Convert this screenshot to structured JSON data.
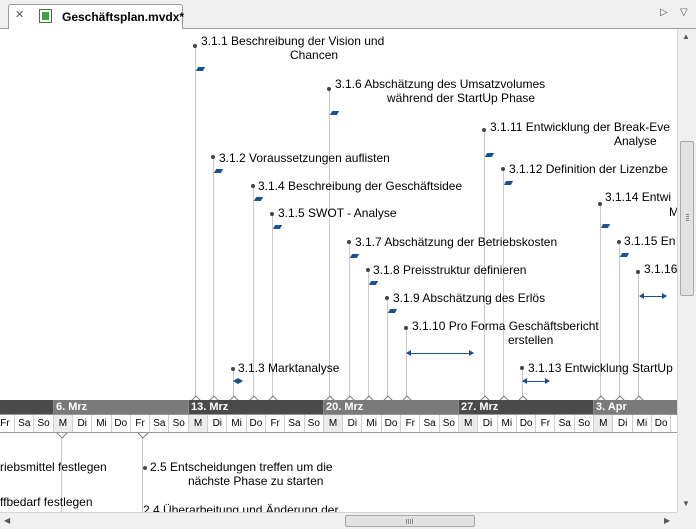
{
  "tab": {
    "title": "Geschäftsplan.mvdx*",
    "close_icon": "close-icon",
    "file_icon": "visio-file-icon"
  },
  "tasks": {
    "t311": "3.1.1  Beschreibung der Vision und",
    "t311b": "Chancen",
    "t316": "3.1.6  Abschätzung des Umsatzvolumes",
    "t316b": "während der StartUp Phase",
    "t3111": "3.1.11  Entwicklung der Break-Eve",
    "t3111b": "Analyse",
    "t312": "3.1.2  Voraussetzungen auflisten",
    "t3112": "3.1.12  Definition der Lizenzbe",
    "t314": "3.1.4  Beschreibung der Geschäftsidee",
    "t3114": "3.1.14  Entwi",
    "t3114b": "M",
    "t315": "3.1.5  SWOT - Analyse",
    "t3115": "3.1.15  En",
    "t317": "3.1.7  Abschätzung der Betriebskosten",
    "t3116": "3.1.16",
    "t318": "3.1.8  Preisstruktur definieren",
    "t319": "3.1.9  Abschätzung des Erlös",
    "t3110": "3.1.10  Pro Forma Geschäftsbericht",
    "t3110b": "erstellen",
    "t313": "3.1.3  Marktanalyse",
    "t3113": "3.1.13  Entwicklung StartUp"
  },
  "weeks": [
    "6. Mrz",
    "13. Mrz",
    "20. Mrz",
    "27. Mrz",
    "3. Apr"
  ],
  "days": [
    "Fr",
    "Sa",
    "So",
    "M",
    "Di",
    "Mi",
    "Do",
    "Fr",
    "Sa",
    "So",
    "M",
    "Di",
    "Mi",
    "Do",
    "Fr",
    "Sa",
    "So",
    "M",
    "Di",
    "Mi",
    "Do",
    "Fr",
    "Sa",
    "So",
    "M",
    "Di",
    "Mi",
    "Do",
    "Fr",
    "Sa",
    "So",
    "M",
    "Di",
    "Mi",
    "Do"
  ],
  "lower": {
    "l1": "riebsmittel festlegen",
    "l2": "ffbedarf festlegen",
    "l3": "2.5  Entscheidungen treffen um die",
    "l3b": "nächste Phase zu starten",
    "l4": "2.4  Überarbeitung und Änderung der"
  }
}
